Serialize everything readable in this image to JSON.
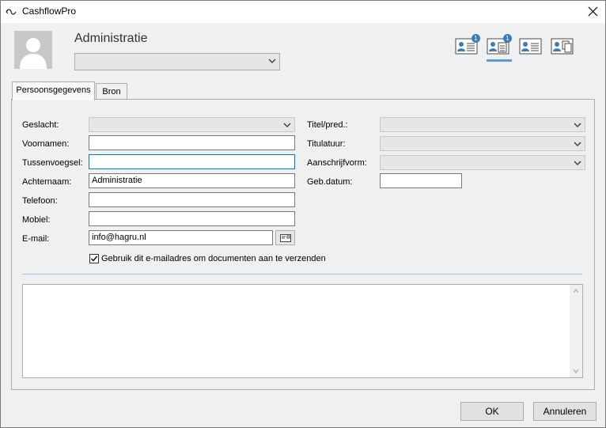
{
  "window": {
    "title": "CashflowPro",
    "icon": "app-logo-icon"
  },
  "header": {
    "title": "Administratie",
    "select_value": "",
    "view_buttons": [
      {
        "icon": "contact-card-icon",
        "badge": "1"
      },
      {
        "icon": "contact-document-icon",
        "badge": "1"
      },
      {
        "icon": "contact-list-icon",
        "badge": ""
      },
      {
        "icon": "contact-copy-icon",
        "badge": ""
      }
    ]
  },
  "tabs": [
    {
      "label": "Persoonsgegevens",
      "active": true
    },
    {
      "label": "Bron",
      "active": false
    }
  ],
  "form": {
    "geslacht": {
      "label": "Geslacht:",
      "value": ""
    },
    "voornamen": {
      "label": "Voornamen:",
      "value": ""
    },
    "tussenvoegsel": {
      "label": "Tussenvoegsel:",
      "value": ""
    },
    "achternaam": {
      "label": "Achternaam:",
      "value": "Administratie"
    },
    "telefoon": {
      "label": "Telefoon:",
      "value": ""
    },
    "mobiel": {
      "label": "Mobiel:",
      "value": ""
    },
    "email": {
      "label": "E-mail:",
      "value": "info@hagru.nl"
    },
    "titel": {
      "label": "Titel/pred.:",
      "value": ""
    },
    "titulatuur": {
      "label": "Titulatuur:",
      "value": ""
    },
    "aanschrijfvorm": {
      "label": "Aanschrijfvorm:",
      "value": ""
    },
    "gebdatum": {
      "label": "Geb.datum:",
      "value": ""
    },
    "email_checkbox": {
      "label": "Gebruik dit e-mailadres om documenten aan te verzenden",
      "checked": true
    }
  },
  "notes": {
    "value": ""
  },
  "buttons": {
    "ok": "OK",
    "cancel": "Annuleren"
  },
  "colors": {
    "accent": "#0078d7",
    "badge": "#3d7ab7",
    "underline": "#5a9bd5"
  }
}
